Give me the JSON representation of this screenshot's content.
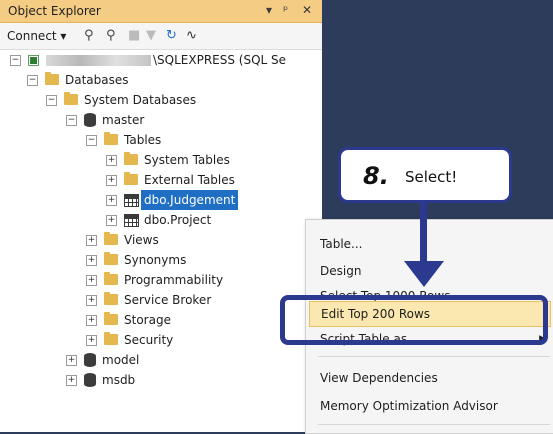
{
  "panel": {
    "title": "Object Explorer",
    "title_icons": [
      "▾",
      "ᵖ",
      "✕"
    ],
    "connect_label": "Connect ▾"
  },
  "tree": {
    "server_label": "\\SQLEXPRESS (SQL Se",
    "databases": "Databases",
    "system_databases": "System Databases",
    "master": "master",
    "tables": "Tables",
    "system_tables": "System Tables",
    "external_tables": "External Tables",
    "judgement": "dbo.Judgement",
    "project": "dbo.Project",
    "views": "Views",
    "synonyms": "Synonyms",
    "programmability": "Programmability",
    "service_broker": "Service Broker",
    "storage": "Storage",
    "security": "Security",
    "model": "model",
    "msdb": "msdb"
  },
  "menu": {
    "table": "Table...",
    "design": "Design",
    "select_top": "Select Top 1000 Rows",
    "edit_top": "Edit Top 200 Rows",
    "script_table": "Script Table as",
    "view_deps": "View Dependencies",
    "memory_adv": "Memory Optimization Advisor"
  },
  "callout": {
    "number": "8.",
    "text": "Select!"
  },
  "colors": {
    "title_bar": "#f5cc84",
    "selection": "#1f6fc5",
    "callout_border": "#2b3a8f",
    "menu_highlight": "#fbe7b0"
  }
}
